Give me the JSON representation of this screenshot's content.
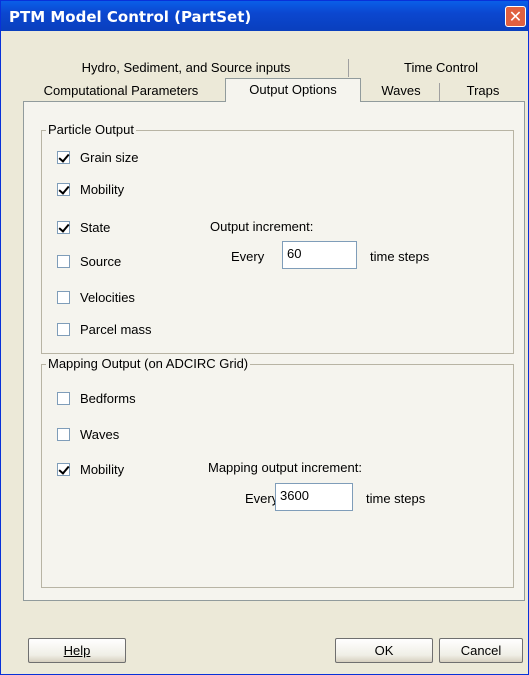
{
  "window": {
    "title": "PTM Model Control (PartSet)",
    "close_glyph": "✕"
  },
  "tabs": {
    "row1": [
      {
        "label": "Hydro, Sediment, and Source inputs"
      },
      {
        "label": "Time Control"
      }
    ],
    "row2": [
      {
        "label": "Computational Parameters"
      },
      {
        "label": "Output Options",
        "active": true
      },
      {
        "label": "Waves"
      },
      {
        "label": "Traps"
      }
    ]
  },
  "particle_output": {
    "group_label": "Particle Output",
    "items": [
      {
        "label": "Grain size",
        "checked": true
      },
      {
        "label": "Mobility",
        "checked": true
      },
      {
        "label": "State",
        "checked": true
      },
      {
        "label": "Source",
        "checked": false
      },
      {
        "label": "Velocities",
        "checked": false
      },
      {
        "label": "Parcel mass",
        "checked": false
      }
    ],
    "increment_label": "Output increment:",
    "every_label": "Every",
    "increment_value": "60",
    "unit_label": "time steps"
  },
  "mapping_output": {
    "group_label": "Mapping Output (on ADCIRC Grid)",
    "items": [
      {
        "label": "Bedforms",
        "checked": false
      },
      {
        "label": "Waves",
        "checked": false
      },
      {
        "label": "Mobility",
        "checked": true
      }
    ],
    "increment_label": "Mapping output increment:",
    "every_label": "Every",
    "increment_value": "3600",
    "unit_label": "time steps"
  },
  "buttons": {
    "help": "Help",
    "ok": "OK",
    "cancel": "Cancel"
  }
}
